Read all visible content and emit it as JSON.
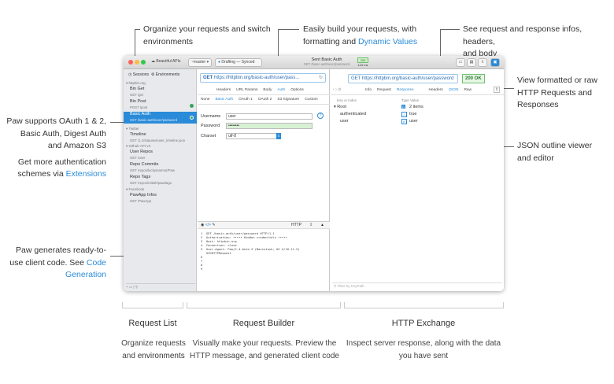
{
  "annotations": {
    "top_left": {
      "line1": "Organize your requests and switch",
      "line2": "environments"
    },
    "top_mid": {
      "line1": "Easily build your requests, with",
      "line2_pre": "formatting and ",
      "line2_link": "Dynamic Values"
    },
    "top_right": {
      "line1": "See request and response infos, headers,",
      "line2": "and body"
    },
    "right_1": {
      "line1": "View formatted or raw",
      "line2": "HTTP Requests and",
      "line3": "Responses"
    },
    "right_2": {
      "line1": "JSON outline viewer",
      "line2": "and editor"
    },
    "left_1": {
      "line1": "Paw supports OAuth 1 & 2,",
      "line2": "Basic Auth, Digest Auth",
      "line3": "and Amazon S3",
      "line4": "Get more authentication",
      "line5_pre": "schemes via ",
      "line5_link": "Extensions"
    },
    "left_2": {
      "line1": "Paw generates ready-to-",
      "line2_pre": "use client code. See ",
      "line2_link": "Code",
      "line3_link": "Generation"
    }
  },
  "window": {
    "app_name": "Beautiful APIs",
    "branch": "~master",
    "sync": "Drafting — Synced",
    "status_title": "Sent Basic Auth",
    "status_sub": "GET /basic-auth/user/password",
    "status_code": "200",
    "status_size": "124 ms",
    "sidebar": {
      "tab_sessions": "Sessions",
      "tab_environments": "Environments",
      "groups": [
        "httpbin.org",
        "Twitter",
        "Github API v3",
        "Facebook"
      ],
      "items": [
        {
          "name": "Bin Get",
          "sub": "GET /get"
        },
        {
          "name": "Bin Post",
          "sub": "POST /post"
        },
        {
          "name": "Basic Auth",
          "sub": "GET /basic-auth/user/password"
        },
        {
          "name": "Timeline",
          "sub": "GET /1.1/statuses/user_timeline.json"
        },
        {
          "name": "Repo Commits",
          "sub": "GET /repos/luckymarmot/Paw"
        },
        {
          "name": "Repo Tags",
          "sub": "GET /repos/mittsh/paw/tags"
        },
        {
          "name": "PawApp Infos",
          "sub": "GET /PawApp"
        },
        {
          "name": "User Repos",
          "sub": "GET /user"
        }
      ]
    },
    "builder": {
      "url_method": "GET",
      "url_value": "https://httpbin.org/basic-auth/user/pass...",
      "tabs": [
        "Headers",
        "URL Params",
        "Body",
        "Auth",
        "Options"
      ],
      "auth_tabs": [
        "None",
        "Basic Auth",
        "OAuth 1",
        "OAuth 2",
        "S3 Signature",
        "Custom"
      ],
      "username_label": "Username",
      "username_value": "user",
      "password_label": "Password",
      "password_value": "••••••••",
      "charset_label": "Charset",
      "charset_value": "utf-8",
      "code_lang": "HTTP",
      "code_lines": [
        "1  GET /basic-auth/user/password HTTP/1.1",
        "2  Authorization: ••••• Hidden credentials •••••",
        "3  Host: httpbin.org",
        "4  Connection: close",
        "5  User-Agent: Paw/2.4-beta.3 (Macintosh; OS X/10.11.5)",
        "   GCDHTTPRequest",
        "6",
        "7",
        "8",
        "9"
      ]
    },
    "exchange": {
      "url_value": "GET https://httpbin.org/basic-auth/user/password",
      "status": "200 OK",
      "tabs": [
        "Info",
        "Request",
        "Response",
        "Headers",
        "JSON",
        "Raw"
      ],
      "col_key": "Key or index",
      "col_type": "Type Value",
      "rows": [
        {
          "key": "Root",
          "type": "{}",
          "value": "2 items"
        },
        {
          "key": "authenticated",
          "type": "✓",
          "value": "true"
        },
        {
          "key": "user",
          "type": "A",
          "value": "user"
        }
      ],
      "filter_placeholder": "Filter by KeyPath"
    }
  },
  "captions": {
    "list": {
      "title": "Request List",
      "line1": "Organize requests",
      "line2_pre": "and ",
      "line2_link": "environments"
    },
    "builder": {
      "title": "Request Builder",
      "line1": "Visually make your requests. Preview the",
      "line2": "HTTP message, and generated client code"
    },
    "exchange": {
      "title": "HTTP Exchange",
      "line1": "Inspect server response, along with the data",
      "line2": "you have sent"
    }
  }
}
